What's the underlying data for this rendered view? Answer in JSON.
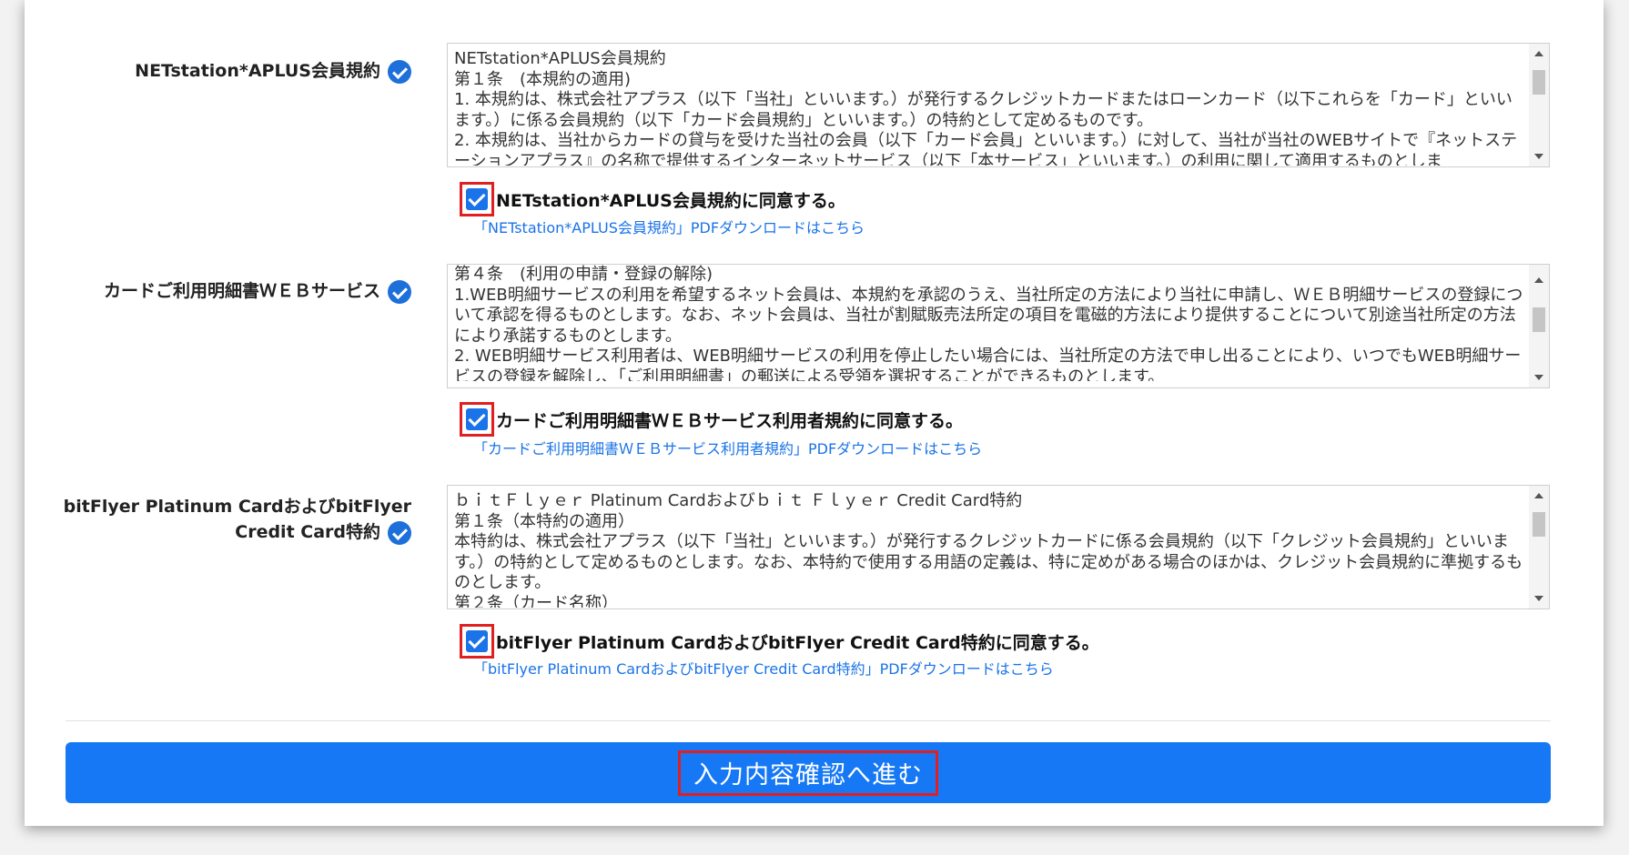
{
  "sections": [
    {
      "label": "NETstation*APLUS会員規約",
      "terms": "NETstation*APLUS会員規約\n第１条　(本規約の適用)\n1. 本規約は、株式会社アプラス（以下「当社」といいます。）が発行するクレジットカードまたはローンカード（以下これらを「カード」といいます。）に係る会員規約（以下「カード会員規約」といいます。）の特約として定めるものです。\n2. 本規約は、当社からカードの貸与を受けた当社の会員（以下「カード会員」といいます。）に対して、当社が当社のWEBサイトで『ネットステーションアプラス』の名称で提供するインターネットサービス（以下「本サービス」といいます。）の利用に関して適用するものとしま",
      "agree": "NETstation*APLUS会員規約に同意する。",
      "pdf": "「NETstation*APLUS会員規約」PDFダウンロードはこちら"
    },
    {
      "label": "カードご利用明細書ＷＥＢサービス",
      "terms": "第４条　(利用の申請・登録の解除)\n1.WEB明細サービスの利用を希望するネット会員は、本規約を承認のうえ、当社所定の方法により当社に申請し、ＷＥＢ明細サービスの登録について承認を得るものとします。なお、ネット会員は、当社が割賦販売法所定の項目を電磁的方法により提供することについて別途当社所定の方法により承諾するものとします。\n2. WEB明細サービス利用者は、WEB明細サービスの利用を停止したい場合には、当社所定の方法で申し出ることにより、いつでもWEB明細サービスの登録を解除し、「ご利用明細書」の郵送による受領を選択することができるものとします。",
      "agree": "カードご利用明細書ＷＥＢサービス利用者規約に同意する。",
      "pdf": "「カードご利用明細書ＷＥＢサービス利用者規約」PDFダウンロードはこちら"
    },
    {
      "label_line1": "bitFlyer Platinum CardおよびbitFlyer",
      "label_line2": "Credit Card特約",
      "terms": "ｂｉｔＦｌｙｅｒ Platinum Cardおよびｂｉｔ Ｆｌｙｅｒ Credit Card特約\n第１条（本特約の適用）\n本特約は、株式会社アプラス（以下「当社」といいます。）が発行するクレジットカードに係る会員規約（以下「クレジット会員規約」といいます。）の特約として定めるものとします。なお、本特約で使用する用語の定義は、特に定めがある場合のほかは、クレジット会員規約に準拠するものとします。\n第２条（カード名称）",
      "agree": "bitFlyer Platinum CardおよびbitFlyer Credit Card特約に同意する。",
      "pdf": "「bitFlyer Platinum CardおよびbitFlyer Credit Card特約」PDFダウンロードはこちら"
    }
  ],
  "submit_label": "入力内容確認へ進む",
  "colors": {
    "accent": "#1678f5",
    "highlight": "#e02020",
    "link": "#1a73e8"
  }
}
